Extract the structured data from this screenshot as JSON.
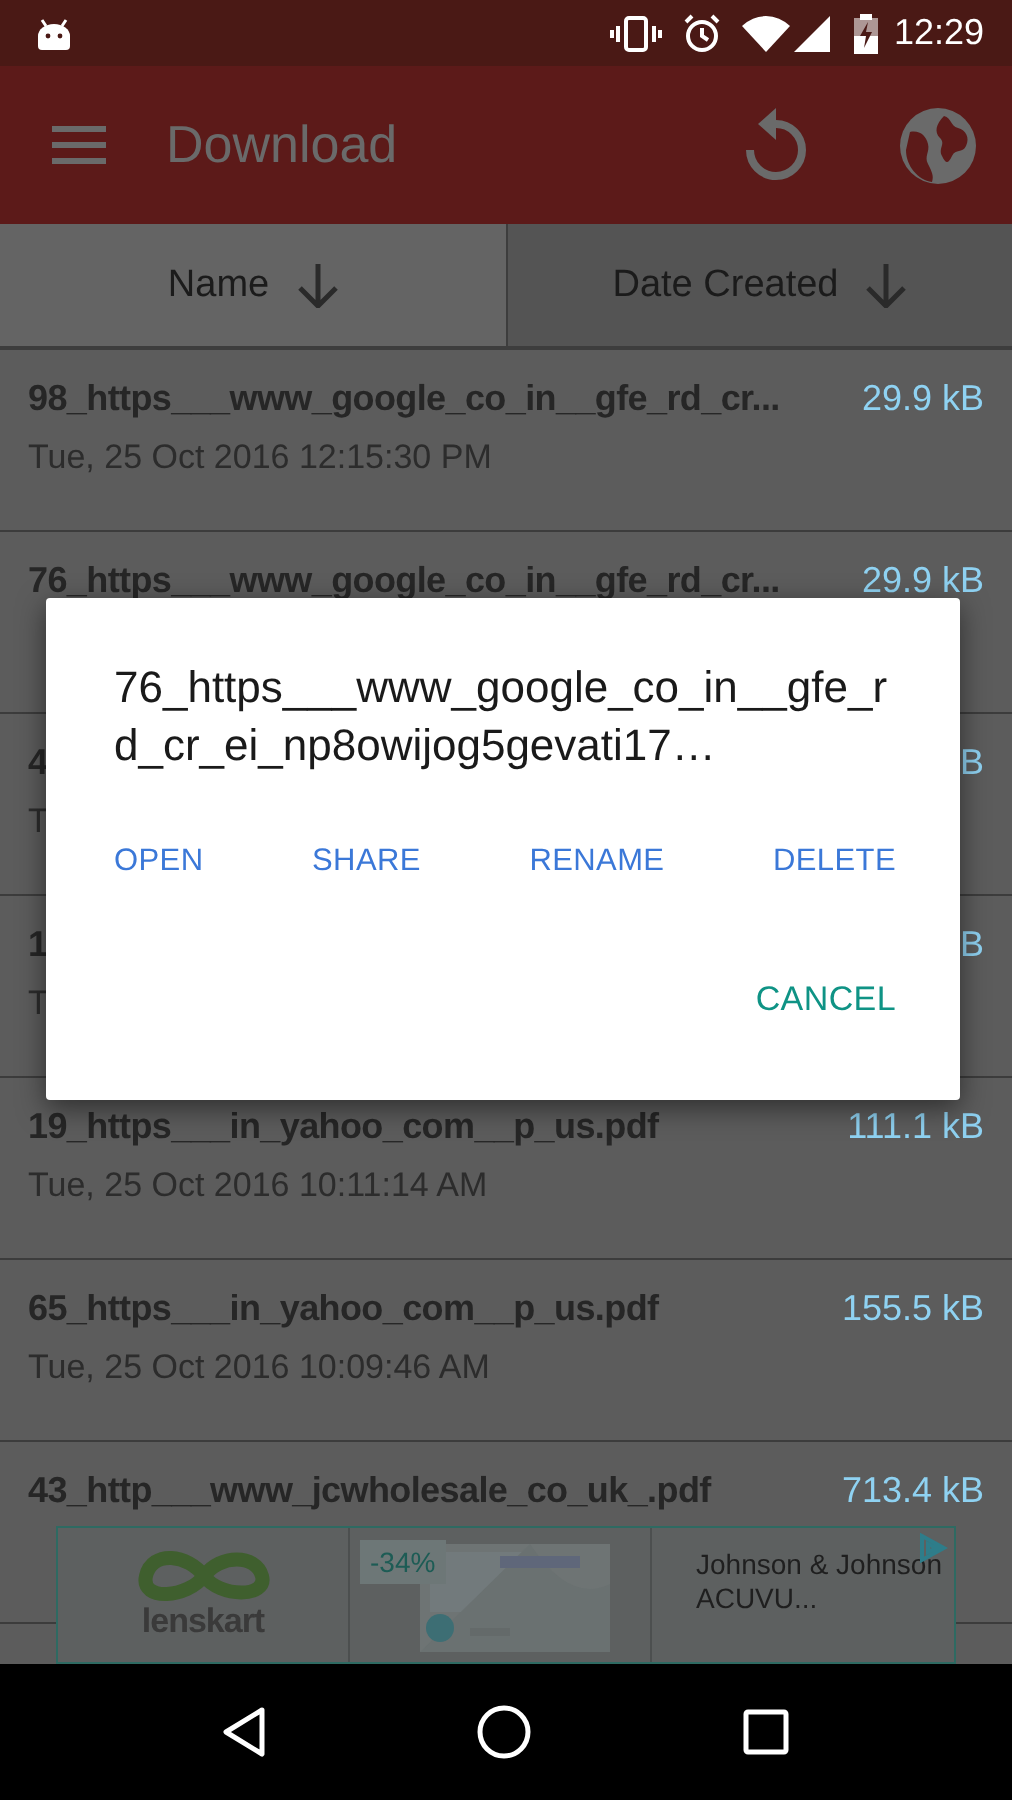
{
  "status_bar": {
    "time": "12:29"
  },
  "toolbar": {
    "title": "Download"
  },
  "sort_header": [
    {
      "label": "Name",
      "selected": false
    },
    {
      "label": "Date Created",
      "selected": true
    }
  ],
  "files": [
    {
      "name": "98_https___www_google_co_in__gfe_rd_cr...",
      "date": "Tue, 25 Oct 2016 12:15:30 PM",
      "size": "29.9 kB"
    },
    {
      "name": "76_https___www_google_co_in__gfe_rd_cr...",
      "size": "29.9 kB"
    },
    {
      "name": "4",
      "date": "T",
      "size": "B"
    },
    {
      "name": "1",
      "date": "T",
      "size": "B"
    },
    {
      "name": "19_https___in_yahoo_com__p_us.pdf",
      "date": "Tue, 25 Oct 2016 10:11:14 AM",
      "size": "111.1 kB"
    },
    {
      "name": "65_https___in_yahoo_com__p_us.pdf",
      "date": "Tue, 25 Oct 2016 10:09:46 AM",
      "size": "155.5 kB"
    },
    {
      "name": "43_http___www_jcwholesale_co_uk_.pdf",
      "size": "713.4 kB"
    }
  ],
  "dialog": {
    "title": "76_https___www_google_co_in__gfe_rd_cr_ei_np8owijog5gevati17…",
    "actions": [
      "OPEN",
      "SHARE",
      "RENAME",
      "DELETE"
    ],
    "cancel": "CANCEL"
  },
  "ad": {
    "brand": "lenskart",
    "discount": "-34%",
    "text": "Johnson & Johnson ACUVU..."
  }
}
